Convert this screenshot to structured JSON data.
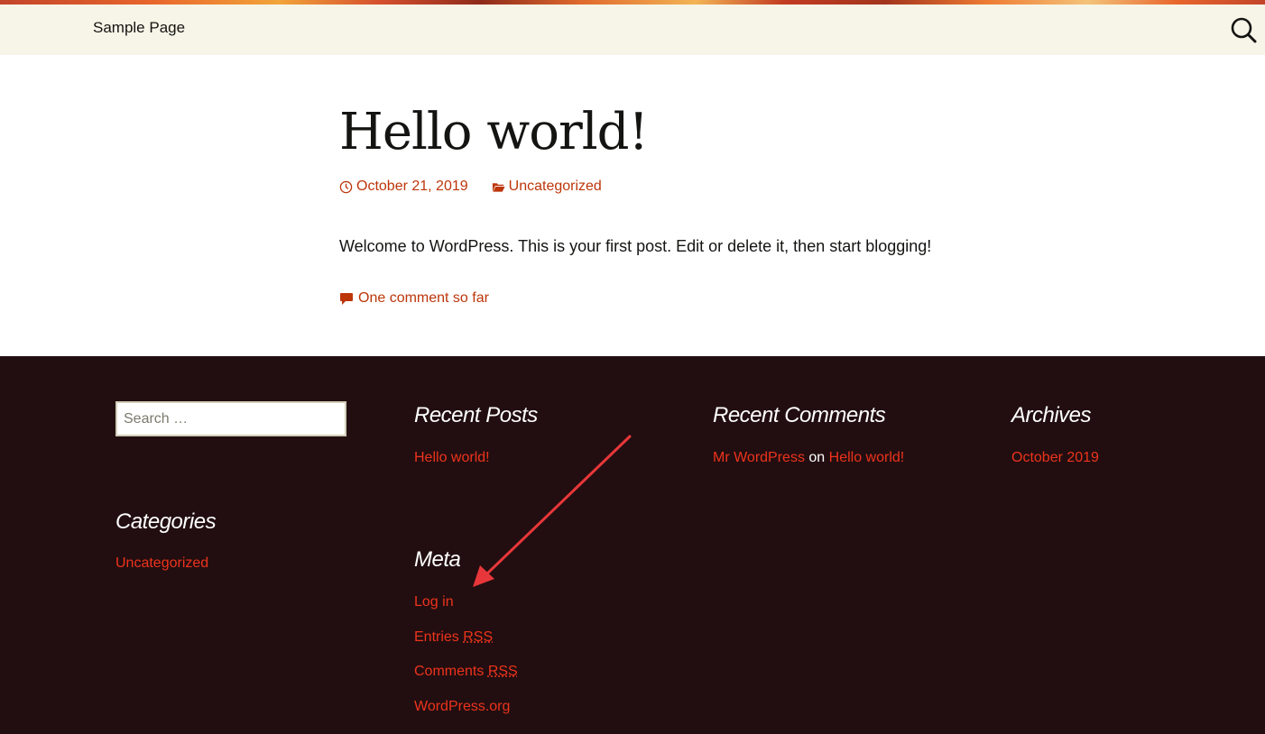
{
  "nav": {
    "sample_page": "Sample Page"
  },
  "post": {
    "title": "Hello world!",
    "date": "October 21, 2019",
    "category": "Uncategorized",
    "content": "Welcome to WordPress. This is your first post. Edit or delete it, then start blogging!",
    "comments_link": "One comment so far"
  },
  "footer": {
    "search_placeholder": "Search …",
    "recent_posts": {
      "title": "Recent Posts",
      "items": [
        "Hello world!"
      ]
    },
    "recent_comments": {
      "title": "Recent Comments",
      "author": "Mr WordPress",
      "on": "on",
      "post": "Hello world!"
    },
    "archives": {
      "title": "Archives",
      "items": [
        "October 2019"
      ]
    },
    "categories": {
      "title": "Categories",
      "items": [
        "Uncategorized"
      ]
    },
    "meta": {
      "title": "Meta",
      "login": "Log in",
      "entries_prefix": "Entries",
      "comments_prefix": "Comments",
      "rss": "RSS",
      "wordpress_org": "WordPress.org"
    }
  },
  "colors": {
    "accent": "#bc360a",
    "footer_link": "#ed331c",
    "footer_bg": "#220e10",
    "nav_bg": "#f7f5e7",
    "annotation_arrow": "#e8373a"
  },
  "icons": [
    "search-icon",
    "clock-icon",
    "folder-icon",
    "comment-bubble-icon",
    "annotation-arrow"
  ]
}
